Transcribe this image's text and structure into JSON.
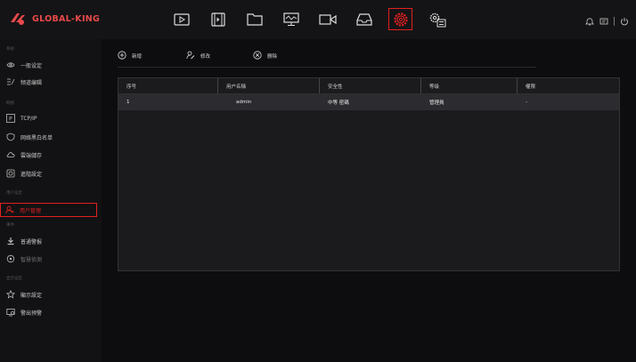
{
  "brand": {
    "name": "GLOBAL-KING",
    "color": "#e84a4a"
  },
  "accent": "#e02020",
  "nav": [
    {
      "name": "playback-icon",
      "active": false
    },
    {
      "name": "video-icon",
      "active": false
    },
    {
      "name": "folder-icon",
      "active": false
    },
    {
      "name": "monitor-icon",
      "active": false
    },
    {
      "name": "camera-icon",
      "active": false
    },
    {
      "name": "storage-icon",
      "active": false
    },
    {
      "name": "settings-icon",
      "active": true
    },
    {
      "name": "system-settings-icon",
      "active": false
    }
  ],
  "sidebar": {
    "sections": [
      "系统",
      "网络",
      "用户设定",
      "事件",
      "显示设定"
    ],
    "items": [
      {
        "label": "一般设定"
      },
      {
        "label": "频道编辑"
      },
      {
        "label": "TCP/IP"
      },
      {
        "label": "网络黑白名单"
      },
      {
        "label": "雲端儲存"
      },
      {
        "label": "進階設定"
      },
      {
        "label": "用户管理"
      },
      {
        "label": "普通警报"
      },
      {
        "label": "智慧侦测"
      },
      {
        "label": "顯示設定"
      },
      {
        "label": "警出预警"
      }
    ]
  },
  "actions": {
    "add": "新增",
    "edit": "修改",
    "delete": "删除"
  },
  "table": {
    "headers": [
      "序号",
      "用户名稱",
      "安全性",
      "等级",
      "權限"
    ],
    "rows": [
      [
        "1",
        "admin",
        "中等 密碼",
        "管理員",
        "-"
      ]
    ]
  }
}
